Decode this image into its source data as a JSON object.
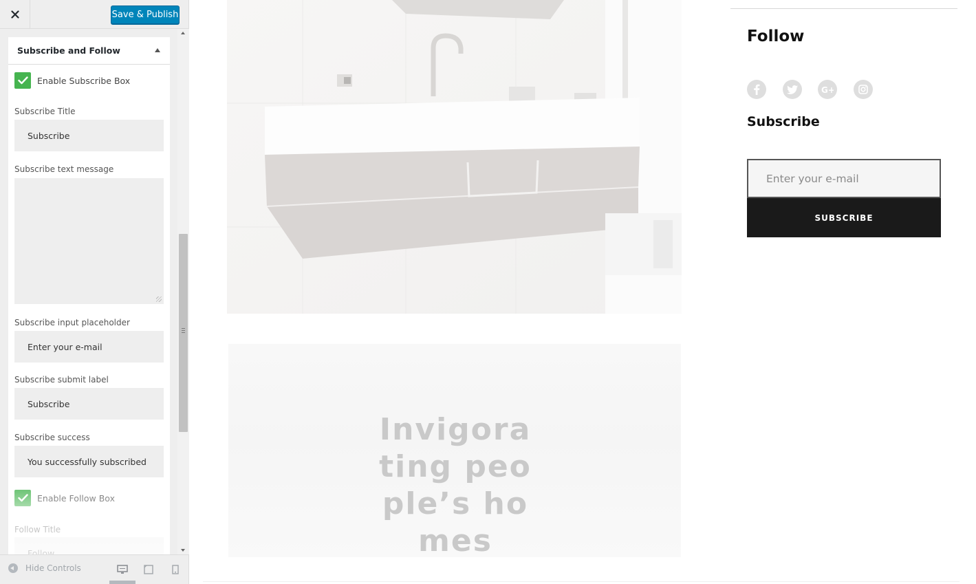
{
  "customizer": {
    "save_label": "Save & Publish",
    "section_title": "Subscribe and Follow",
    "enable_subscribe_label": "Enable Subscribe Box",
    "subscribe_title": {
      "label": "Subscribe Title",
      "value": "Subscribe"
    },
    "subscribe_text": {
      "label": "Subscribe text message",
      "value": ""
    },
    "subscribe_placeholder": {
      "label": "Subscribe input placeholder",
      "value": "Enter your e-mail"
    },
    "subscribe_submit": {
      "label": "Subscribe submit label",
      "value": "Subscribe"
    },
    "subscribe_success": {
      "label": "Subscribe success",
      "value": "You successfully subscribed"
    },
    "enable_follow_label": "Enable Follow Box",
    "follow_title": {
      "label": "Follow Title",
      "value": "Follow"
    },
    "footer": {
      "hide_controls_label": "Hide Controls"
    },
    "checkbox_color": "#46b450",
    "primary_button_color": "#0085ba"
  },
  "preview": {
    "card_title": "Invigorating people’s homes",
    "follow_heading": "Follow",
    "social_icons": [
      "facebook-icon",
      "twitter-icon",
      "google-plus-icon",
      "instagram-icon"
    ],
    "subscribe_heading": "Subscribe",
    "email_placeholder": "Enter your e-mail",
    "subscribe_button": "SUBSCRIBE"
  }
}
